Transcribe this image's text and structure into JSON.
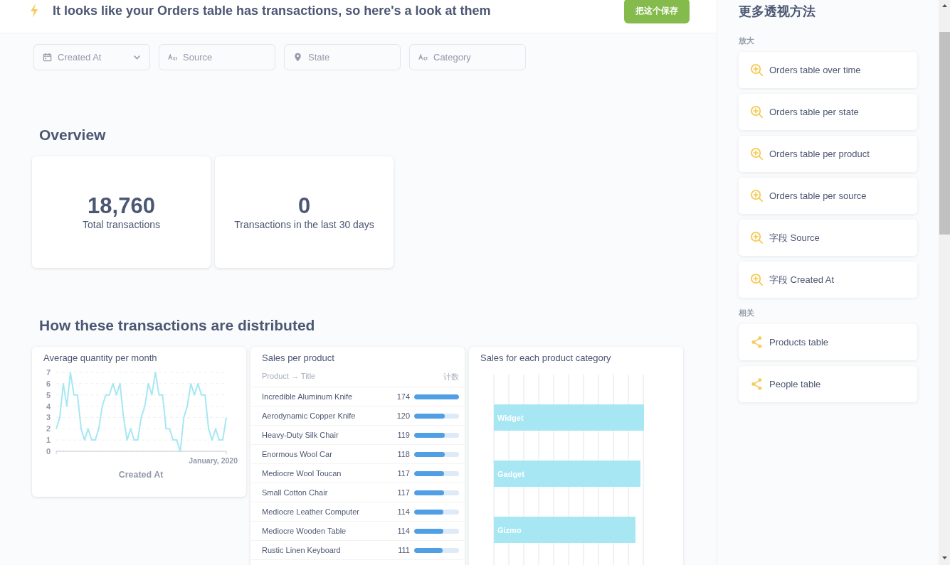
{
  "header": {
    "title": "It looks like your Orders table has transactions, so here's a look at them",
    "save_button": "把这个保存"
  },
  "filters": [
    {
      "kind": "date",
      "label": "Created At"
    },
    {
      "kind": "text",
      "label": "Source"
    },
    {
      "kind": "location",
      "label": "State"
    },
    {
      "kind": "text",
      "label": "Category"
    }
  ],
  "overview": {
    "heading": "Overview",
    "cards": [
      {
        "value": "18,760",
        "label": "Total transactions"
      },
      {
        "value": "0",
        "label": "Transactions in the last 30 days"
      }
    ]
  },
  "distribution": {
    "heading": "How these transactions are distributed",
    "quantity_chart": {
      "title": "Average quantity per month",
      "x_axis_end_label": "January, 2020",
      "chart_data": {
        "type": "line",
        "xlabel": "Created At",
        "yticks": [
          0,
          1,
          2,
          3,
          4,
          5,
          6,
          7
        ],
        "ylim": [
          0,
          7
        ],
        "grid": true,
        "series": [
          {
            "color": "#a6e7f3",
            "values": [
              2,
              3,
              6,
              4,
              7,
              5,
              5,
              2,
              1,
              2,
              1,
              1,
              2,
              4,
              5,
              5,
              6,
              5,
              6,
              3,
              1,
              2,
              1,
              1,
              3,
              4,
              6,
              5,
              7,
              5,
              5,
              2,
              2,
              1,
              1,
              0,
              3,
              4,
              6,
              5,
              6,
              5,
              5,
              2,
              1,
              2,
              1,
              1,
              3
            ]
          }
        ]
      }
    },
    "product_table": {
      "title": "Sales per product",
      "columns": [
        "Product → Title",
        "计数"
      ],
      "rows": [
        {
          "name": "Incredible Aluminum Knife",
          "count": "174",
          "level": 1
        },
        {
          "name": "Aerodynamic Copper Knife",
          "count": "120",
          "level": 0.69
        },
        {
          "name": "Heavy-Duty Silk Chair",
          "count": "119",
          "level": 0.684
        },
        {
          "name": "Enormous Wool Car",
          "count": "118",
          "level": 0.678
        },
        {
          "name": "Mediocre Wool Toucan",
          "count": "117",
          "level": 0.672
        },
        {
          "name": "Small Cotton Chair",
          "count": "117",
          "level": 0.672
        },
        {
          "name": "Mediocre Leather Computer",
          "count": "114",
          "level": 0.655
        },
        {
          "name": "Mediocre Wooden Table",
          "count": "114",
          "level": 0.655
        },
        {
          "name": "Rustic Linen Keyboard",
          "count": "111",
          "level": 0.638
        }
      ]
    },
    "category_chart": {
      "title": "Sales for each product category",
      "bars": [
        "Widget",
        "Gadget",
        "Gizmo"
      ]
    }
  },
  "sidebar": {
    "title": "更多透视方法",
    "sections": [
      {
        "kind": "zoom",
        "heading": "放大",
        "items": [
          "Orders table over time",
          "Orders table per state",
          "Orders table per product",
          "Orders table per source",
          "字段 Source",
          "字段 Created At"
        ]
      },
      {
        "kind": "related",
        "heading": "相关",
        "items": [
          "Products table",
          "People table"
        ]
      }
    ]
  }
}
